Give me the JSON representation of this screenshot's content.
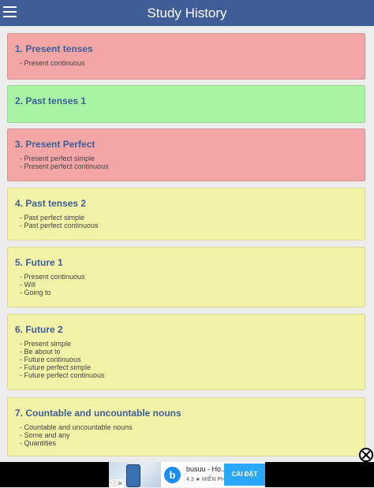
{
  "header": {
    "title": "Study History",
    "menu_icon": "hamburger-menu-icon"
  },
  "lessons": [
    {
      "title": "1. Present tenses",
      "status": "red",
      "items": [
        "- Present continuous"
      ]
    },
    {
      "title": "2. Past tenses 1",
      "status": "green",
      "items": []
    },
    {
      "title": "3. Present Perfect",
      "status": "red",
      "items": [
        "- Present perfect simple",
        "- Present perfect continuous"
      ]
    },
    {
      "title": "4. Past tenses 2",
      "status": "yellow",
      "items": [
        "- Past perfect simple",
        "- Past perfect continuous"
      ]
    },
    {
      "title": "5. Future 1",
      "status": "yellow",
      "items": [
        "- Present continuous",
        "- Will",
        "- Going to"
      ]
    },
    {
      "title": "6. Future 2",
      "status": "yellow",
      "items": [
        "- Present simple",
        "- Be about to",
        "- Future continuous",
        "- Future perfect simple",
        "- Future perfect continuous"
      ]
    },
    {
      "title": "7. Countable and uncountable nouns",
      "status": "yellow",
      "items": [
        "- Countable and uncountable nouns",
        "- Some and any",
        "- Quantities"
      ]
    }
  ],
  "colors": {
    "header": "#3f5e98",
    "red": "#f4a6a6",
    "green": "#a9f4a4",
    "yellow": "#f3f3a8",
    "title_text": "#3f5e98"
  },
  "ad": {
    "app_name": "busuu - Họ...",
    "rating": "4.3 ★ MIỄN PHÍ",
    "cta": "CÀI ĐẶT",
    "logo_letter": "b",
    "close_icon": "close-circle-icon"
  }
}
